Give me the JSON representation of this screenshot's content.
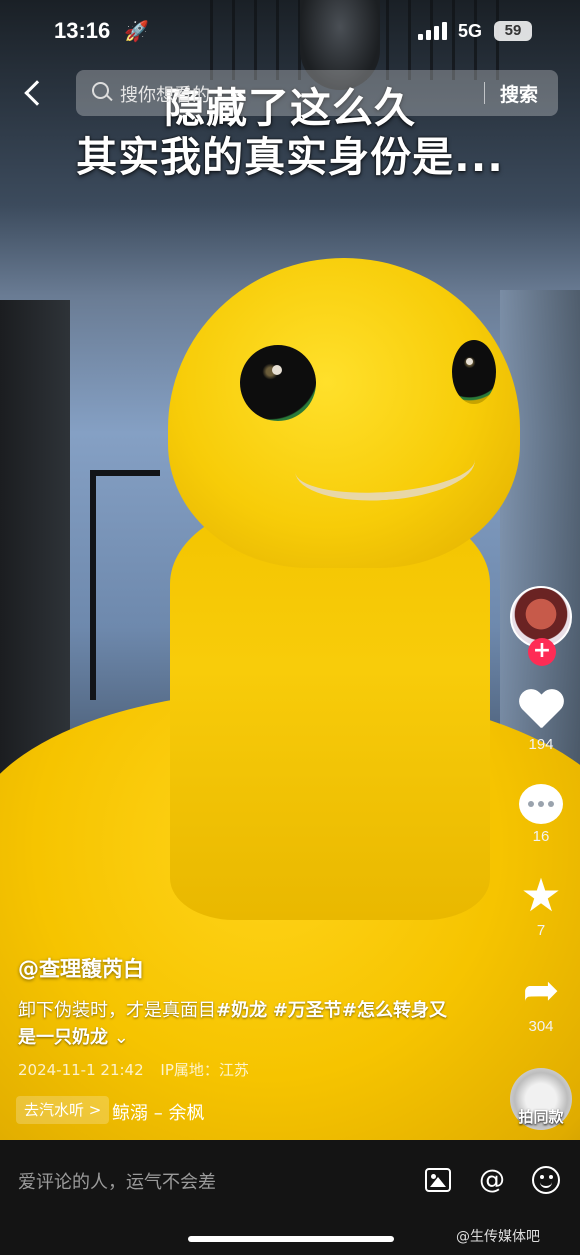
{
  "status_bar": {
    "time": "13:16",
    "network": "5G",
    "battery": "59"
  },
  "search": {
    "placeholder": "搜你想看的",
    "button_label": "搜索"
  },
  "caption": {
    "line1": "隐藏了这么久",
    "line2": "其实我的真实身份是..."
  },
  "rail": {
    "likes": "194",
    "comments": "16",
    "favorites": "7",
    "shares": "304",
    "follow_symbol": "+",
    "same_label": "拍同款"
  },
  "post": {
    "author": "@查理馥芮白",
    "description_text": "卸下伪装时，才是真面目",
    "tags": [
      "#奶龙",
      "#万圣节",
      "#怎么转身又是一只奶龙"
    ],
    "expand_glyph": "⌄",
    "date": "2024-11-1 21:42",
    "ip_location": "IP属地：江苏"
  },
  "music": {
    "listen_label": "去汽水听 >",
    "song": "鲸溺 – 余枫"
  },
  "comment_bar": {
    "placeholder": "爱评论的人，运气不会差",
    "at_symbol": "@",
    "watermark": "@生传媒体吧"
  },
  "colors": {
    "accent": "#fe2c55",
    "comment_bar_bg": "#141414"
  }
}
